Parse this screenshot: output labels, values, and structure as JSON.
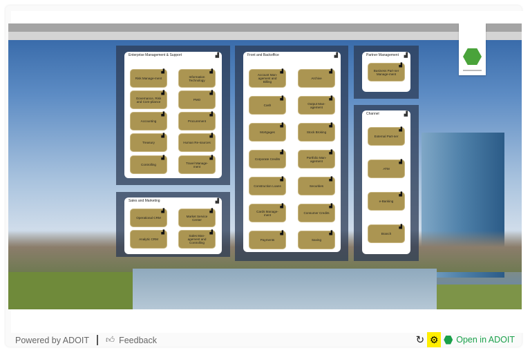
{
  "groups": [
    {
      "id": "ems",
      "title": "Enterprise Management & Support",
      "items": [
        "Risk Manage-ment",
        "Information Technology",
        "Governance, Risk and Com-pliance",
        "PMO",
        "Accounting",
        "Procurement",
        "Treasury",
        "Human Re-sources",
        "Controlling",
        "Travel Manage-ment"
      ]
    },
    {
      "id": "sales",
      "title": "Sales and Marketing",
      "items": [
        "Operational CRM",
        "Market Service Center",
        "Analytic CRM",
        "Sales Man-agement and Controlling"
      ]
    },
    {
      "id": "front",
      "title": "Front and Backoffice",
      "items": [
        "Account Man-agement and Billing",
        "Archive",
        "Cash",
        "Output Man-agement",
        "Mortgages",
        "Stock Broking",
        "Corporate Credits",
        "Portfolio Man-agement",
        "Construction Loans",
        "Securities",
        "Cards Manage-ment",
        "Consumer Credits",
        "Payments",
        "Saving"
      ]
    },
    {
      "id": "partner",
      "title": "Partner Management",
      "items": [
        "Business Part-ner Manage-ment"
      ]
    },
    {
      "id": "channel",
      "title": "Channel",
      "items": [
        "External Part-ner",
        "ATM",
        "e-Banking",
        "Branch"
      ]
    }
  ],
  "footer": {
    "powered": "Powered by ADOIT",
    "feedback": "Feedback",
    "open": "Open in ADOIT"
  },
  "icons": {
    "item": "level-bars-icon",
    "feedback": "thumbs-up-icon",
    "refresh": "refresh-icon",
    "settings": "gear-icon",
    "open": "adoit-hexagon-icon"
  },
  "colors": {
    "item_fill": "#ab9552",
    "open_link": "#1aa04a",
    "settings_highlight": "#ffee00",
    "logo": "#4aa33a"
  }
}
